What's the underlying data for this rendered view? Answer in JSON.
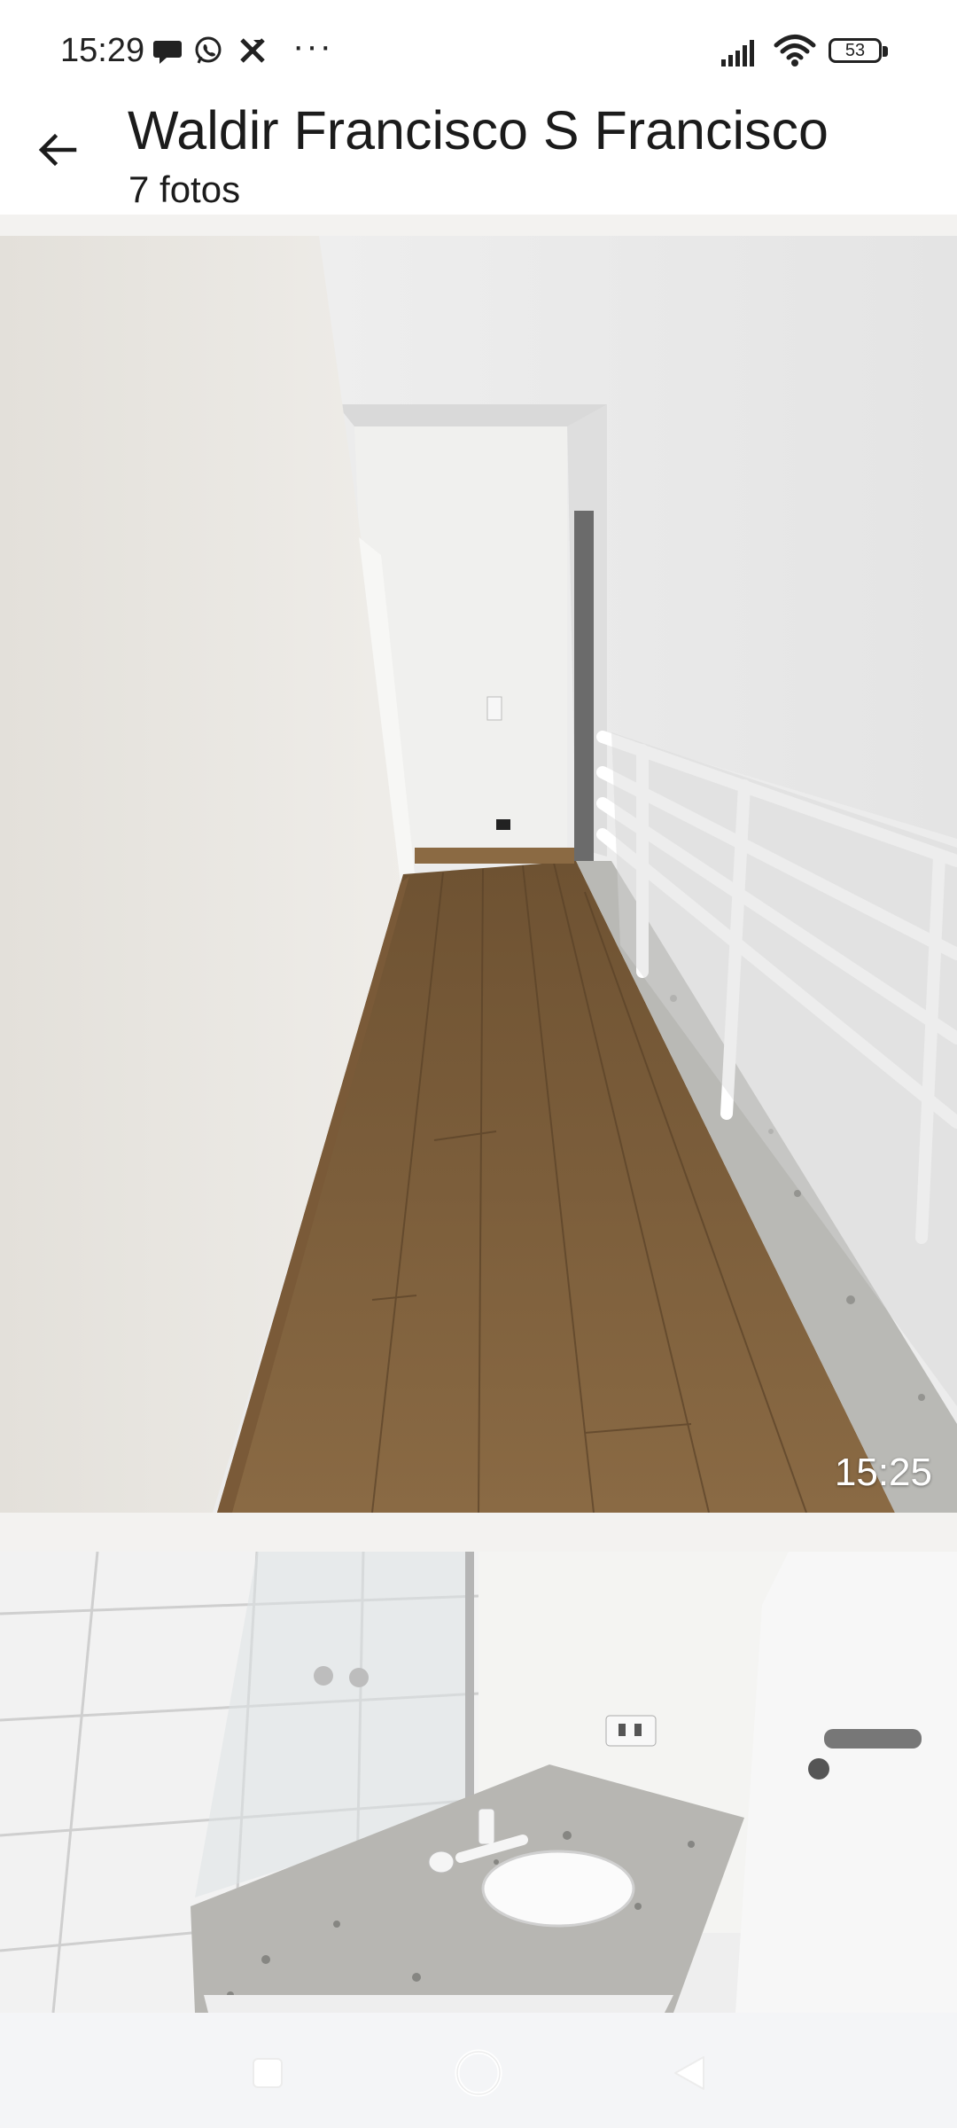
{
  "status_bar": {
    "time": "15:29",
    "notification_icons": [
      "chat-bubble-icon",
      "whatsapp-icon",
      "x-app-icon"
    ],
    "more": "···",
    "battery_level": "53",
    "signal_icon": "signal-bars-icon",
    "wifi_icon": "wifi-icon"
  },
  "header": {
    "back_icon": "arrow-left-icon",
    "title": "Waldir Francisco S Francisco",
    "subtitle": "7 fotos"
  },
  "media": [
    {
      "time_label": "15:25"
    },
    {
      "time_label": ""
    }
  ],
  "nav_bar": {
    "recents_icon": "square-icon",
    "home_icon": "circle-icon",
    "back_icon": "triangle-back-icon"
  },
  "colors": {
    "background": "#ffffff",
    "band": "#f3f2f0",
    "nav_bg": "#f4f5f7"
  }
}
